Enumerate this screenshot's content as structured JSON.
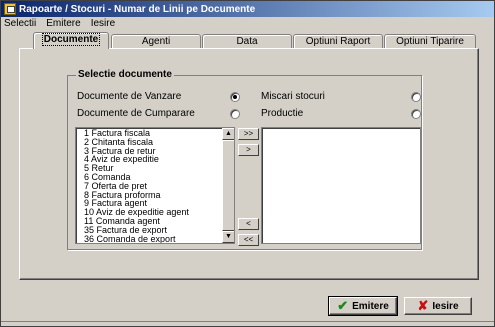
{
  "window": {
    "title": "Rapoarte / Stocuri - Numar de Linii pe Documente"
  },
  "menu": [
    "Selectii",
    "Emitere",
    "Iesire"
  ],
  "tabs": [
    "Documente",
    "Agenti",
    "Data",
    "Optiuni Raport",
    "Optiuni Tiparire"
  ],
  "group": {
    "title": "Selectie documente",
    "options": [
      {
        "label": "Documente de Vanzare",
        "checked": true
      },
      {
        "label": "Miscari stocuri",
        "checked": false
      },
      {
        "label": "Documente de Cumparare",
        "checked": false
      },
      {
        "label": "Productie",
        "checked": false
      }
    ]
  },
  "available_list": [
    "1 Factura fiscala",
    "2 Chitanta fiscala",
    "3 Factura de retur",
    "4 Aviz de expeditie",
    "5 Retur",
    "6 Comanda",
    "7 Oferta de pret",
    "8 Factura proforma",
    "9 Factura agent",
    "10 Aviz de expeditie agent",
    "11 Comanda agent",
    "35 Factura de export",
    "36 Comanda de export"
  ],
  "move_buttons": {
    "add_all": ">>",
    "add": ">",
    "remove": "<",
    "remove_all": "<<"
  },
  "buttons": {
    "emit": "Emitere",
    "exit": "Iesire"
  }
}
